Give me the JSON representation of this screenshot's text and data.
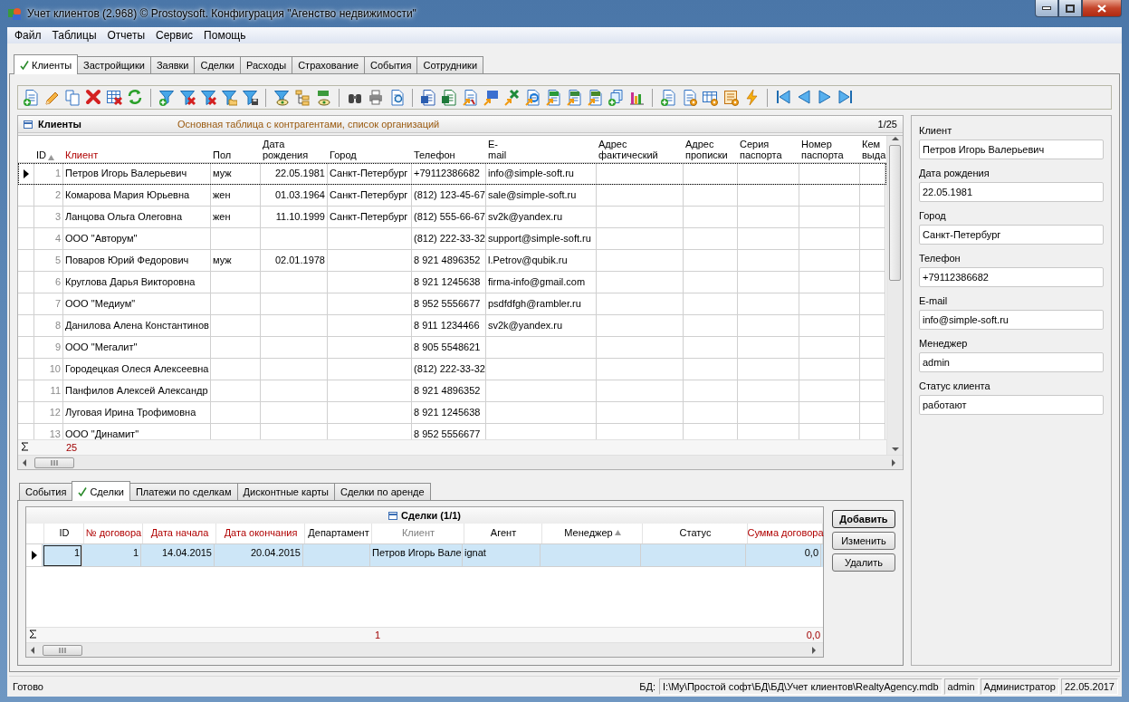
{
  "window": {
    "title": "Учет клиентов (2.968) © Prostoysoft. Конфигурация \"Агенство недвижимости\""
  },
  "menu": [
    "Файл",
    "Таблицы",
    "Отчеты",
    "Сервис",
    "Помощь"
  ],
  "tabs": [
    {
      "label": "Клиенты",
      "selected": true
    },
    {
      "label": "Застройщики",
      "selected": false
    },
    {
      "label": "Заявки",
      "selected": false
    },
    {
      "label": "Сделки",
      "selected": false
    },
    {
      "label": "Расходы",
      "selected": false
    },
    {
      "label": "Страхование",
      "selected": false
    },
    {
      "label": "События",
      "selected": false
    },
    {
      "label": "Сотрудники",
      "selected": false
    }
  ],
  "clients": {
    "title": "Клиенты",
    "description": "Основная таблица с контрагентами, список организаций",
    "counter": "1/25",
    "columns": [
      {
        "label": "ID",
        "kind": "normal",
        "sorted": true
      },
      {
        "label": "Клиент",
        "kind": "required",
        "sorted": false
      },
      {
        "label": "Пол",
        "kind": "normal",
        "sorted": false
      },
      {
        "label": "Дата рождения",
        "kind": "normal",
        "sorted": false
      },
      {
        "label": "Город",
        "kind": "normal",
        "sorted": false
      },
      {
        "label": "Телефон",
        "kind": "normal",
        "sorted": false
      },
      {
        "label": "E-mail",
        "kind": "normal",
        "sorted": false
      },
      {
        "label": "Адрес фактический",
        "kind": "normal",
        "sorted": false
      },
      {
        "label": "Адрес прописки",
        "kind": "normal",
        "sorted": false
      },
      {
        "label": "Серия паспорта",
        "kind": "normal",
        "sorted": false
      },
      {
        "label": "Номер паспорта",
        "kind": "normal",
        "sorted": false
      },
      {
        "label": "Кем выда",
        "kind": "normal",
        "sorted": false
      }
    ],
    "rows": [
      {
        "selected": true,
        "cells": [
          "1",
          "Петров Игорь Валерьевич",
          "муж",
          "22.05.1981",
          "Санкт-Петербург",
          "+79112386682",
          "info@simple-soft.ru",
          "",
          "",
          "",
          "",
          ""
        ]
      },
      {
        "selected": false,
        "cells": [
          "2",
          "Комарова Мария Юрьевна",
          "жен",
          "01.03.1964",
          "Санкт-Петербург",
          "(812) 123-45-67",
          "sale@simple-soft.ru",
          "",
          "",
          "",
          "",
          ""
        ]
      },
      {
        "selected": false,
        "cells": [
          "3",
          "Ланцова Ольга Олеговна",
          "жен",
          "11.10.1999",
          "Санкт-Петербург",
          "(812) 555-66-67",
          "sv2k@yandex.ru",
          "",
          "",
          "",
          "",
          ""
        ]
      },
      {
        "selected": false,
        "cells": [
          "4",
          "ООО \"Авторум\"",
          "",
          "",
          "",
          "(812) 222-33-32",
          "support@simple-soft.ru",
          "",
          "",
          "",
          "",
          ""
        ]
      },
      {
        "selected": false,
        "cells": [
          "5",
          "Поваров Юрий Федорович",
          "муж",
          "02.01.1978",
          "",
          "8 921 4896352",
          "l.Petrov@qubik.ru",
          "",
          "",
          "",
          "",
          ""
        ]
      },
      {
        "selected": false,
        "cells": [
          "6",
          "Круглова Дарья Викторовна",
          "",
          "",
          "",
          "8 921 1245638",
          "firma-info@gmail.com",
          "",
          "",
          "",
          "",
          ""
        ]
      },
      {
        "selected": false,
        "cells": [
          "7",
          "ООО \"Медиум\"",
          "",
          "",
          "",
          "8 952 5556677",
          "psdfdfgh@rambler.ru",
          "",
          "",
          "",
          "",
          ""
        ]
      },
      {
        "selected": false,
        "cells": [
          "8",
          "Данилова Алена Константинов",
          "",
          "",
          "",
          "8 911 1234466",
          "sv2k@yandex.ru",
          "",
          "",
          "",
          "",
          ""
        ]
      },
      {
        "selected": false,
        "cells": [
          "9",
          "ООО \"Мегалит\"",
          "",
          "",
          "",
          "8 905 5548621",
          "",
          "",
          "",
          "",
          "",
          ""
        ]
      },
      {
        "selected": false,
        "cells": [
          "10",
          "Городецкая Олеся Алексеевна",
          "",
          "",
          "",
          "(812) 222-33-32",
          "",
          "",
          "",
          "",
          "",
          ""
        ]
      },
      {
        "selected": false,
        "cells": [
          "11",
          "Панфилов Алексей Александр",
          "",
          "",
          "",
          "8 921 4896352",
          "",
          "",
          "",
          "",
          "",
          ""
        ]
      },
      {
        "selected": false,
        "cells": [
          "12",
          "Луговая Ирина Трофимовна",
          "",
          "",
          "",
          "8 921 1245638",
          "",
          "",
          "",
          "",
          "",
          ""
        ]
      },
      {
        "selected": false,
        "cells": [
          "13",
          "ООО \"Динамит\"",
          "",
          "",
          "",
          "8 952 5556677",
          "",
          "",
          "",
          "",
          "",
          ""
        ]
      }
    ],
    "total": "25"
  },
  "client_card": {
    "fields": [
      {
        "label": "Клиент",
        "value": "Петров Игорь Валерьевич"
      },
      {
        "label": "Дата рождения",
        "value": "22.05.1981"
      },
      {
        "label": "Город",
        "value": "Санкт-Петербург"
      },
      {
        "label": "Телефон",
        "value": "+79112386682"
      },
      {
        "label": "E-mail",
        "value": "info@simple-soft.ru"
      },
      {
        "label": "Менеджер",
        "value": "admin"
      },
      {
        "label": "Статус клиента",
        "value": "работают"
      }
    ]
  },
  "detail_tabs": [
    {
      "label": "События",
      "selected": false
    },
    {
      "label": "Сделки",
      "selected": true
    },
    {
      "label": "Платежи по сделкам",
      "selected": false
    },
    {
      "label": "Дисконтные карты",
      "selected": false
    },
    {
      "label": "Сделки по аренде",
      "selected": false
    }
  ],
  "deals": {
    "title": "Сделки (1/1)",
    "columns": [
      {
        "label": "ID",
        "kind": "normal",
        "sorted": false
      },
      {
        "label": "№ договора",
        "kind": "required",
        "sorted": false
      },
      {
        "label": "Дата начала",
        "kind": "required",
        "sorted": false
      },
      {
        "label": "Дата окончания",
        "kind": "required",
        "sorted": false
      },
      {
        "label": "Департамент",
        "kind": "normal",
        "sorted": false
      },
      {
        "label": "Клиент",
        "kind": "readonly",
        "sorted": false
      },
      {
        "label": "Агент",
        "kind": "normal",
        "sorted": false
      },
      {
        "label": "Менеджер",
        "kind": "normal",
        "sorted": true
      },
      {
        "label": "Статус",
        "kind": "normal",
        "sorted": false
      },
      {
        "label": "Сумма договора",
        "kind": "required",
        "sorted": false
      }
    ],
    "rows": [
      {
        "selected": true,
        "cells": [
          "1",
          "1",
          "14.04.2015",
          "20.04.2015",
          "",
          "Петров Игорь Вале",
          "ignat",
          "",
          "",
          "0,0"
        ]
      }
    ],
    "total_count": "1",
    "total_amount": "0,0",
    "buttons": [
      {
        "label": "Добавить",
        "default": true
      },
      {
        "label": "Изменить",
        "default": false
      },
      {
        "label": "Удалить",
        "default": false
      }
    ]
  },
  "status_bar": {
    "status": "Готово",
    "db_label": "БД:",
    "db_path": "I:\\My\\Простой софт\\БД\\БД\\Учет клиентов\\RealtyAgency.mdb",
    "user": "admin",
    "role": "Администратор",
    "date": "22.05.2017"
  }
}
